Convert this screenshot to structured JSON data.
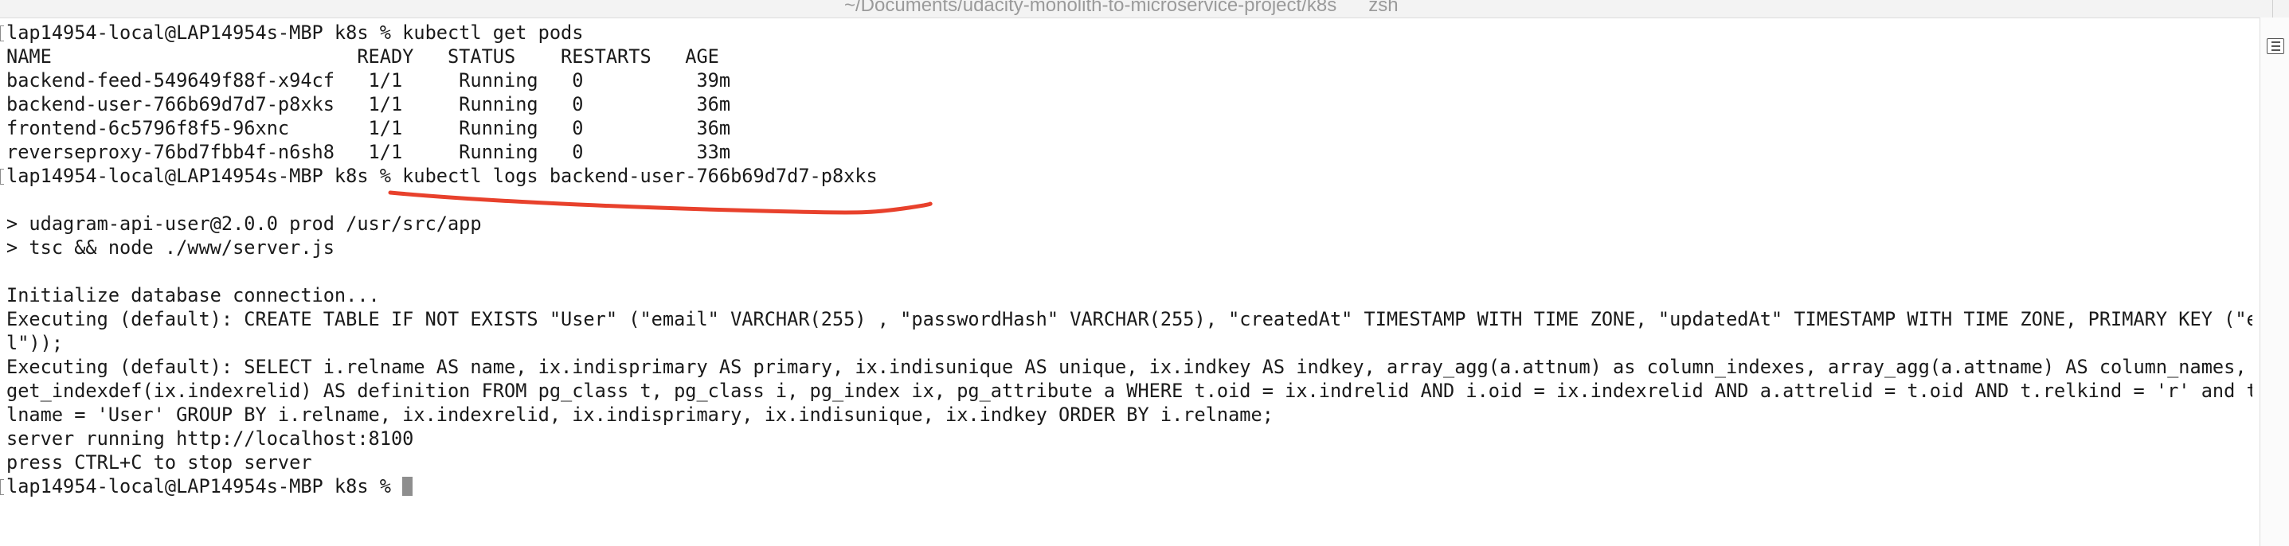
{
  "window": {
    "title": "~/Documents/udacity-monolith-to-microservice-project/k8s",
    "title_suffix": "zsh"
  },
  "terminal": {
    "lines": [
      {
        "text": "lap14954-local@LAP14954s-MBP k8s % kubectl get pods",
        "prompt": true
      },
      {
        "text": "NAME                           READY   STATUS    RESTARTS   AGE",
        "prompt": false
      },
      {
        "text": "backend-feed-549649f88f-x94cf   1/1     Running   0          39m",
        "prompt": false
      },
      {
        "text": "backend-user-766b69d7d7-p8xks   1/1     Running   0          36m",
        "prompt": false
      },
      {
        "text": "frontend-6c5796f8f5-96xnc       1/1     Running   0          36m",
        "prompt": false
      },
      {
        "text": "reverseproxy-76bd7fbb4f-n6sh8   1/1     Running   0          33m",
        "prompt": false
      },
      {
        "text": "lap14954-local@LAP14954s-MBP k8s % kubectl logs backend-user-766b69d7d7-p8xks",
        "prompt": true
      },
      {
        "text": "",
        "prompt": false
      },
      {
        "text": "> udagram-api-user@2.0.0 prod /usr/src/app",
        "prompt": false
      },
      {
        "text": "> tsc && node ./www/server.js",
        "prompt": false
      },
      {
        "text": "",
        "prompt": false
      },
      {
        "text": "Initialize database connection...",
        "prompt": false
      },
      {
        "text": "Executing (default): CREATE TABLE IF NOT EXISTS \"User\" (\"email\" VARCHAR(255) , \"passwordHash\" VARCHAR(255), \"createdAt\" TIMESTAMP WITH TIME ZONE, \"updatedAt\" TIMESTAMP WITH TIME ZONE, PRIMARY KEY (\"emai",
        "prompt": false
      },
      {
        "text": "l\"));",
        "prompt": false
      },
      {
        "text": "Executing (default): SELECT i.relname AS name, ix.indisprimary AS primary, ix.indisunique AS unique, ix.indkey AS indkey, array_agg(a.attnum) as column_indexes, array_agg(a.attname) AS column_names, pg_",
        "prompt": false
      },
      {
        "text": "get_indexdef(ix.indexrelid) AS definition FROM pg_class t, pg_class i, pg_index ix, pg_attribute a WHERE t.oid = ix.indrelid AND i.oid = ix.indexrelid AND a.attrelid = t.oid AND t.relkind = 'r' and t.re",
        "prompt": false
      },
      {
        "text": "lname = 'User' GROUP BY i.relname, ix.indexrelid, ix.indisprimary, ix.indisunique, ix.indkey ORDER BY i.relname;",
        "prompt": false
      },
      {
        "text": "server running http://localhost:8100",
        "prompt": false
      },
      {
        "text": "press CTRL+C to stop server",
        "prompt": false
      },
      {
        "text": "lap14954-local@LAP14954s-MBP k8s % ",
        "prompt": true,
        "cursor": true
      }
    ]
  },
  "annotation": {
    "color": "#e8412c"
  }
}
